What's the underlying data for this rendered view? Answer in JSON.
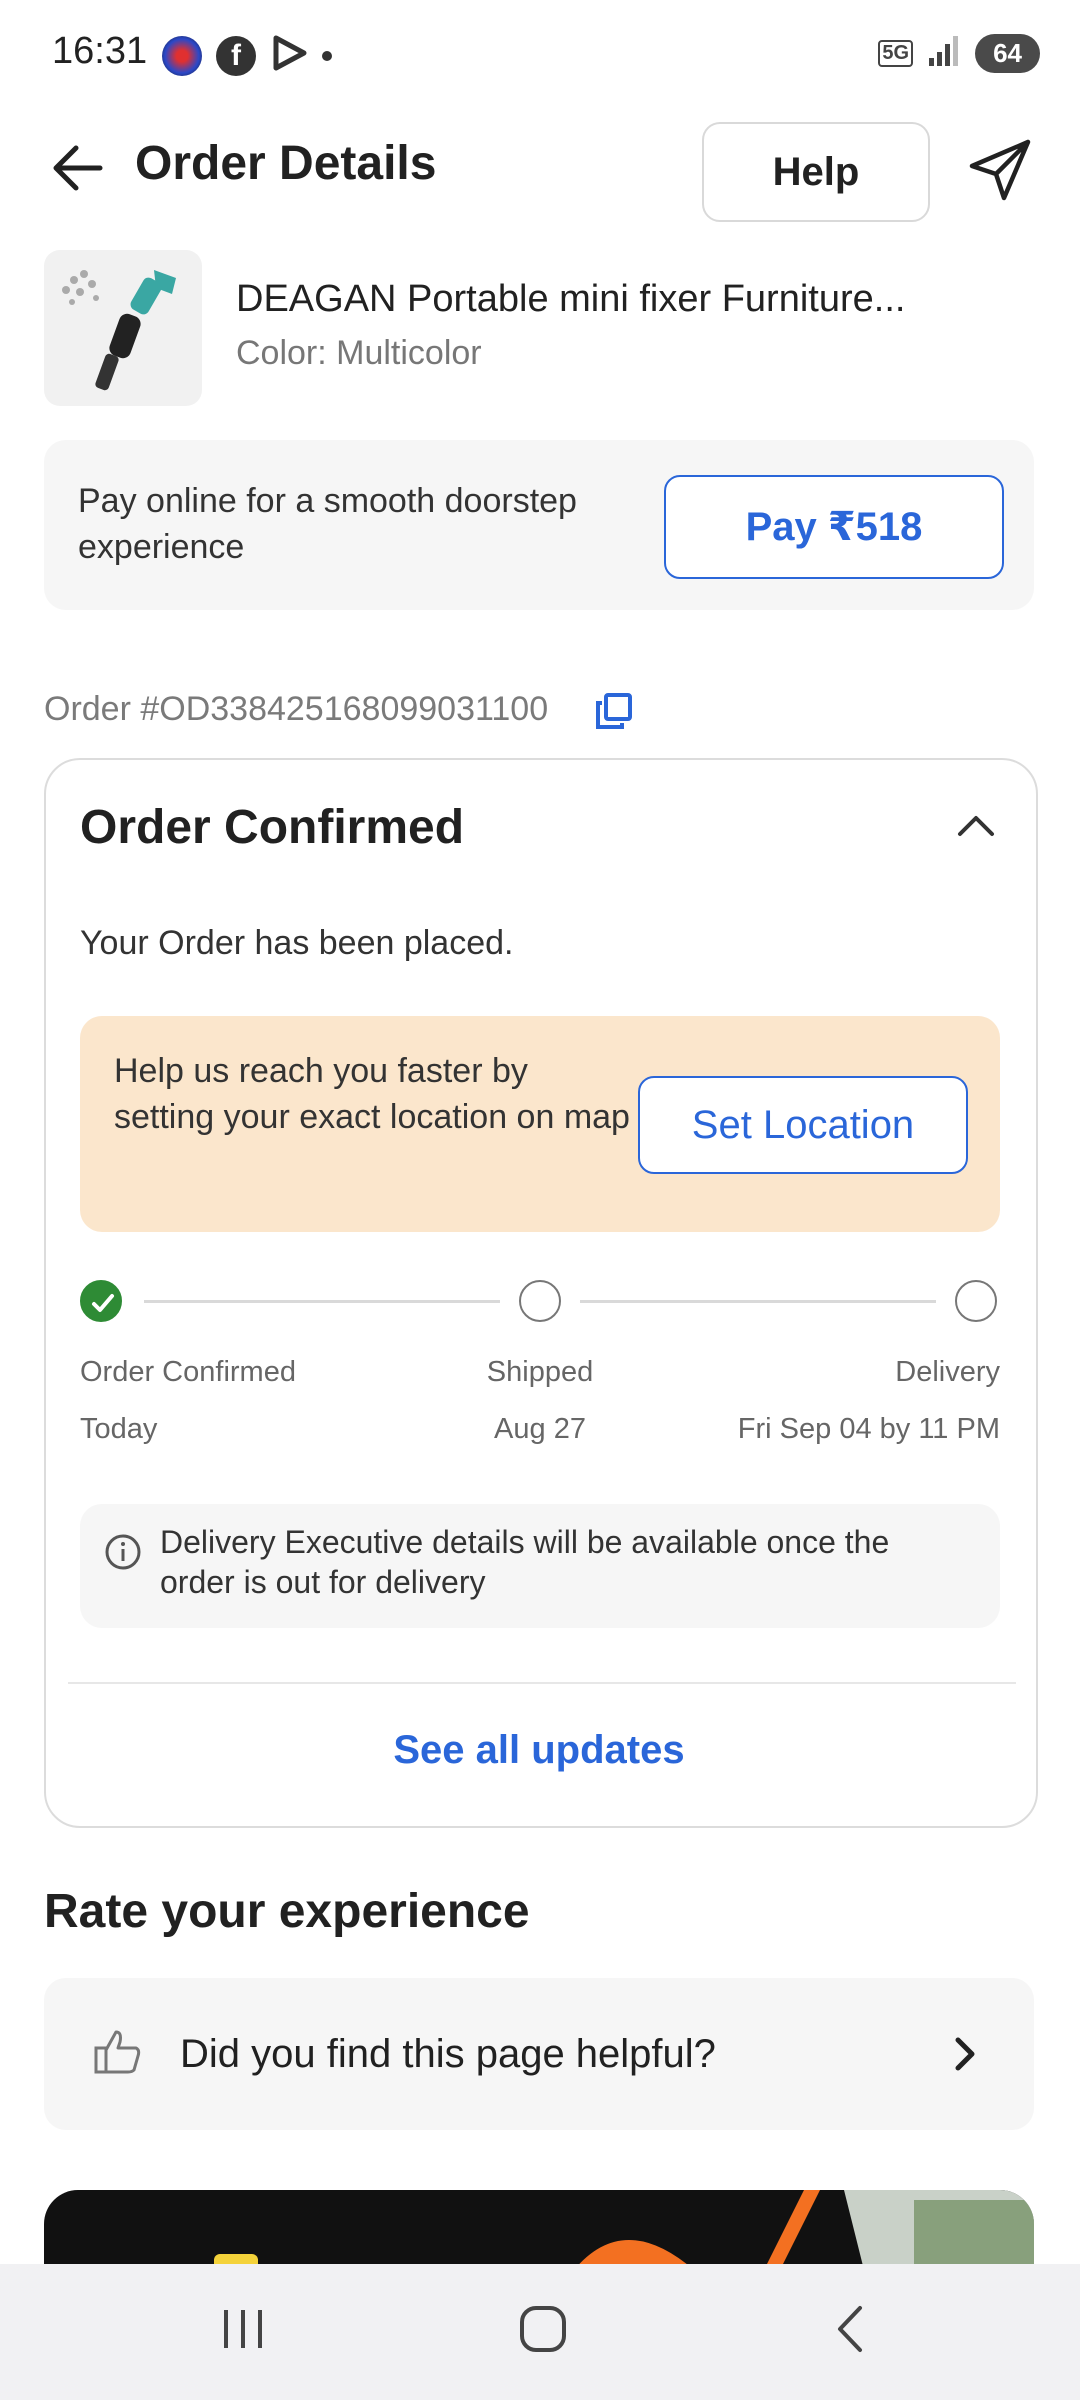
{
  "status_bar": {
    "time": "16:31",
    "network": "5G",
    "battery": "64"
  },
  "header": {
    "title": "Order Details",
    "help_label": "Help"
  },
  "product": {
    "name": "DEAGAN Portable mini fixer Furniture...",
    "color": "Color: Multicolor"
  },
  "payment": {
    "message": "Pay online for a smooth doorstep experience",
    "button_label": "Pay ₹518"
  },
  "order": {
    "id_text": "Order #OD338425168099031100"
  },
  "status_card": {
    "title": "Order Confirmed",
    "subtitle": "Your Order has been placed.",
    "location_prompt": "Help us reach you faster by setting your exact location on map",
    "location_button": "Set Location",
    "timeline": [
      {
        "label": "Order Confirmed",
        "date": "Today",
        "done": true
      },
      {
        "label": "Shipped",
        "date": "Aug 27",
        "done": false
      },
      {
        "label": "Delivery",
        "date": "Fri Sep 04 by 11 PM",
        "done": false
      }
    ],
    "info_text": "Delivery Executive details will be available once the order is out for delivery",
    "see_all_label": "See all updates"
  },
  "rating": {
    "title": "Rate your experience",
    "question": "Did you find this page helpful?"
  },
  "colors": {
    "accent": "#2a66d9",
    "success": "#2e8b35",
    "location_bg": "#fbe6cc"
  },
  "icons": [
    "back-arrow-icon",
    "share-icon",
    "copy-icon",
    "chevron-up-icon",
    "check-icon",
    "info-icon",
    "thumbs-up-icon",
    "chevron-right-icon",
    "recent-apps-icon",
    "home-icon",
    "back-icon"
  ]
}
